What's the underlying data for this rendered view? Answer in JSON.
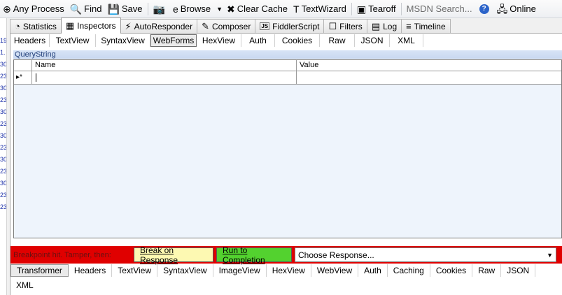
{
  "toolbar": {
    "items": [
      {
        "name": "any-process",
        "icon": "crosshair-icon",
        "glyph": "⊕",
        "label": "Any Process"
      },
      {
        "name": "find",
        "icon": "binoculars-icon",
        "glyph": "🔍",
        "label": "Find"
      },
      {
        "name": "save",
        "icon": "save-icon",
        "glyph": "💾",
        "label": "Save"
      },
      {
        "name": "screenshot",
        "icon": "camera-icon",
        "glyph": "📷",
        "label": ""
      },
      {
        "name": "browse",
        "icon": "ie-icon",
        "glyph": "e",
        "label": "Browse"
      },
      {
        "name": "clear-cache",
        "icon": "eraser-icon",
        "glyph": "✖",
        "label": "Clear Cache"
      },
      {
        "name": "text-wizard",
        "icon": "textwizard-icon",
        "glyph": "T",
        "label": "TextWizard"
      },
      {
        "name": "tearoff",
        "icon": "tearoff-icon",
        "glyph": "▣",
        "label": "Tearoff"
      }
    ],
    "search_placeholder": "MSDN Search...",
    "help_glyph": "?",
    "online_label": "Online"
  },
  "main_tabs": [
    {
      "label": "Statistics",
      "glyph": "◔",
      "active": false
    },
    {
      "label": "Inspectors",
      "glyph": "▦",
      "active": true
    },
    {
      "label": "AutoResponder",
      "glyph": "⚡",
      "active": false
    },
    {
      "label": "Composer",
      "glyph": "✎",
      "active": false
    },
    {
      "label": "FiddlerScript",
      "glyph": "JS",
      "active": false
    },
    {
      "label": "Filters",
      "glyph": "☐",
      "active": false
    },
    {
      "label": "Log",
      "glyph": "▤",
      "active": false
    },
    {
      "label": "Timeline",
      "glyph": "≡",
      "active": false
    }
  ],
  "request_tabs": [
    "Headers",
    "TextView",
    "SyntaxView",
    "WebForms",
    "HexView",
    "Auth",
    "Cookies",
    "Raw",
    "JSON",
    "XML"
  ],
  "request_active": "WebForms",
  "querystring": {
    "title": "QueryString",
    "columns": {
      "name": "Name",
      "value": "Value"
    },
    "new_row_marker": "▸*"
  },
  "breakpoint": {
    "message": "Breakpoint hit. Tamper, then:",
    "break_on_response": "Break on Response",
    "run_to_completion": "Run to Completion",
    "choose_response": "Choose Response..."
  },
  "response_tabs": [
    "Transformer",
    "Headers",
    "TextView",
    "SyntaxView",
    "ImageView",
    "HexView",
    "WebView",
    "Auth",
    "Caching",
    "Cookies",
    "Raw",
    "JSON"
  ],
  "response_tabs_row2": [
    "XML"
  ],
  "response_active": "Transformer",
  "left_strip_digits": [
    "19",
    "1.",
    "30",
    "23",
    "30",
    "23",
    "30",
    "23",
    "30",
    "23",
    "30",
    "23",
    "30",
    "23",
    "23"
  ]
}
